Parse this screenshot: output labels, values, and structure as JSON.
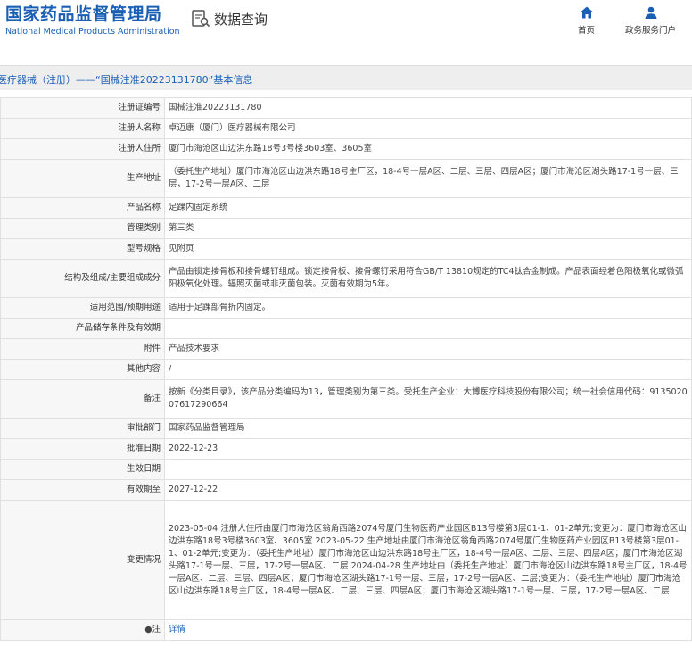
{
  "header": {
    "logo_cn": "国家药品监督管理局",
    "logo_en": "National Medical Products Administration",
    "query_label": "数据查询",
    "nav": [
      {
        "label": "首页",
        "icon": "home-icon"
      },
      {
        "label": "政务服务门户",
        "icon": "user-icon"
      }
    ]
  },
  "title": "医疗器械（注册）——“国械注准20223131780”基本信息",
  "rows": [
    {
      "label": "注册证编号",
      "value": "国械注准20223131780"
    },
    {
      "label": "注册人名称",
      "value": "卓迈康（厦门）医疗器械有限公司"
    },
    {
      "label": "注册人住所",
      "value": "厦门市海沧区山边洪东路18号3号楼3603室、3605室"
    },
    {
      "label": "生产地址",
      "value": "（委托生产地址）厦门市海沧区山边洪东路18号主厂区，18-4号一层A区、二层、三层、四层A区；厦门市海沧区湖头路17-1号一层、三层，17-2号一层A区、二层"
    },
    {
      "label": "产品名称",
      "value": "足踝内固定系统"
    },
    {
      "label": "管理类别",
      "value": "第三类"
    },
    {
      "label": "型号规格",
      "value": "见附页"
    },
    {
      "label": "结构及组成/主要组成成分",
      "value": "产品由锁定接骨板和接骨螺钉组成。锁定接骨板、接骨螺钉采用符合GB/T 13810规定的TC4钛合金制成。产品表面经着色阳极氧化或微弧阳极氧化处理。辐照灭菌或非灭菌包装。灭菌有效期为5年。"
    },
    {
      "label": "适用范围/预期用途",
      "value": "适用于足踝部骨折内固定。"
    },
    {
      "label": "产品储存条件及有效期",
      "value": ""
    },
    {
      "label": "附件",
      "value": "产品技术要求"
    },
    {
      "label": "其他内容",
      "value": "/"
    },
    {
      "label": "备注",
      "value": "按新《分类目录》，该产品分类编码为13，管理类别为第三类。受托生产企业：大博医疗科技股份有限公司；统一社会信用代码：91350200761729066​4"
    },
    {
      "label": "审批部门",
      "value": "国家药品监督管理局"
    },
    {
      "label": "批准日期",
      "value": "2022-12-23"
    },
    {
      "label": "生效日期",
      "value": ""
    },
    {
      "label": "有效期至",
      "value": "2027-12-22"
    },
    {
      "label": "变更情况",
      "value": "2023-05-04 注册人住所由厦门市海沧区翁角西路2074号厦门生物医药产业园区B13号楼第3层01-1、01-2单元;变更为：厦门市海沧区山边洪东路18号3号楼3603室、3605室 2023-05-22 生产地址由厦门市海沧区翁角西路2074号厦门生物医药产业园区B13号楼第3层01-1、01-2单元;变更为：（委托生产地址）厦门市海沧区山边洪东路18号主厂区，18-4号一层A区、二层、三层、四层A区；厦门市海沧区湖头路17-1号一层、三层，17-2号一层A区、二层 2024-04-28 生产地址由（委托生产地址）厦门市海沧区山边洪东路18号主厂区，18-4号一层A区、二层、三层、四层A区；厦门市海沧区湖头路17-1号一层、三层，17-2号一层A区、二层;变更为：（委托生产地址）厦门市海沧区山边洪东路18号主厂区，18-4号一层A区、二层、三层、四层A区；厦门市海沧区湖头路17-1号一层、三层，17-2号一层A区、二层"
    }
  ],
  "note": {
    "label": "注",
    "icon": "pin-icon",
    "link": "详情"
  }
}
